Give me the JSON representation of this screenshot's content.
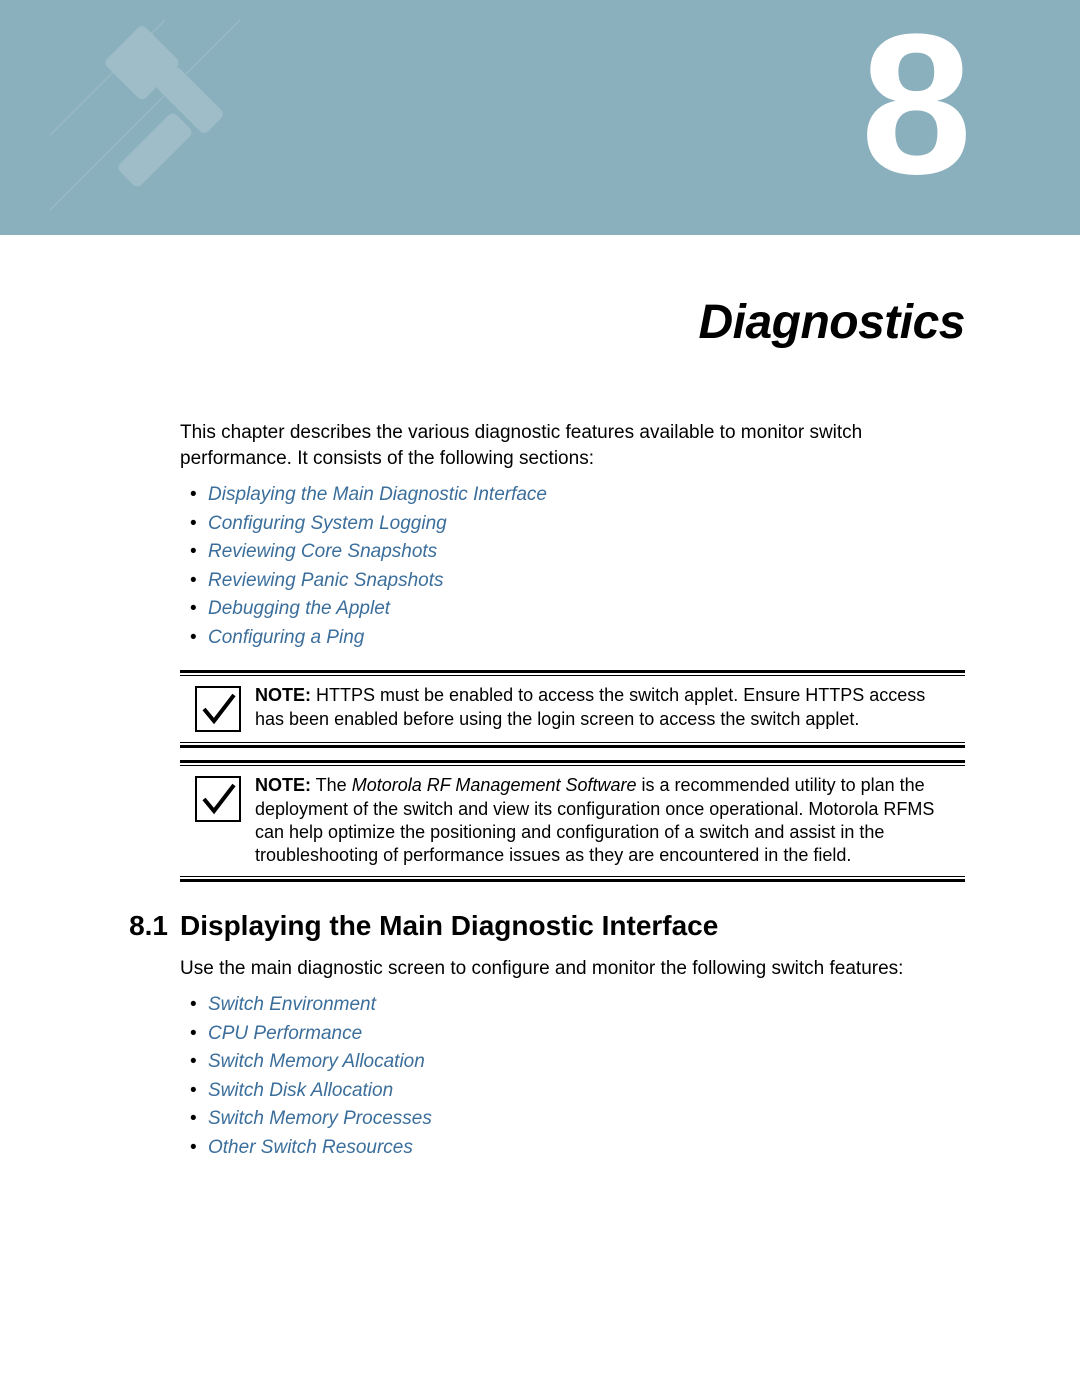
{
  "chapter": {
    "number": "8",
    "title": "Diagnostics"
  },
  "intro": "This chapter describes the various diagnostic features available to monitor switch performance. It consists of the following sections:",
  "sections_list": [
    "Displaying the Main Diagnostic Interface",
    "Configuring System Logging",
    "Reviewing Core Snapshots",
    "Reviewing Panic Snapshots",
    "Debugging the Applet",
    "Configuring a Ping"
  ],
  "note1": {
    "label": "NOTE:",
    "text": " HTTPS must be enabled to access the switch applet. Ensure HTTPS access has been enabled before using the login screen to access the switch applet."
  },
  "note2": {
    "label": "NOTE:",
    "pre": " The ",
    "em": "Motorola RF Management Software",
    "post": " is a recommended utility to plan the deployment of the switch and view its configuration once operational. Motorola RFMS can help optimize the positioning and configuration of a switch and assist in the troubleshooting of performance issues as they are encountered in the field."
  },
  "section_8_1": {
    "num": "8.1",
    "title": "Displaying the Main Diagnostic Interface",
    "intro": "Use the main diagnostic screen to configure and monitor the following switch features:",
    "links": [
      "Switch Environment",
      "CPU Performance",
      "Switch Memory Allocation",
      "Switch Disk Allocation",
      "Switch Memory Processes",
      "Other Switch Resources"
    ]
  }
}
